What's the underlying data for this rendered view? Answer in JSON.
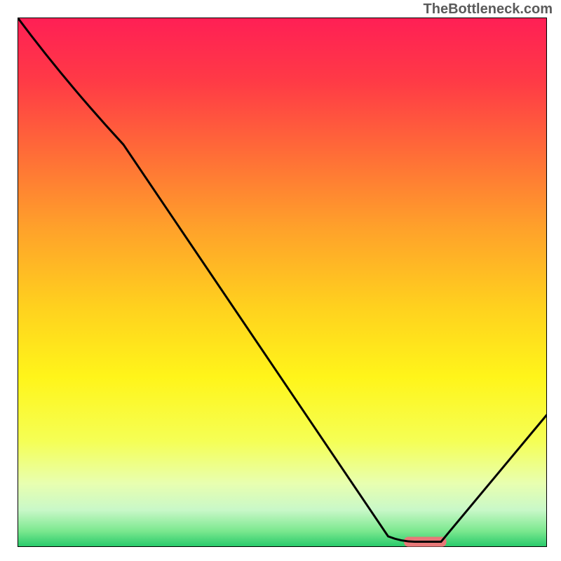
{
  "watermark": "TheBottleneck.com",
  "chart_data": {
    "type": "line",
    "title": "",
    "xlabel": "",
    "ylabel": "",
    "xlim": [
      0,
      100
    ],
    "ylim": [
      0,
      100
    ],
    "series": [
      {
        "name": "bottleneck-curve",
        "x": [
          0,
          20,
          70,
          75,
          80,
          100
        ],
        "values": [
          100,
          76,
          2,
          1,
          1,
          25
        ]
      }
    ],
    "marker": {
      "x_start": 73,
      "x_end": 81,
      "y": 1,
      "color": "#e87878"
    },
    "gradient_stops": [
      {
        "offset": 0,
        "color": "#ff1f55"
      },
      {
        "offset": 12,
        "color": "#ff3a46"
      },
      {
        "offset": 25,
        "color": "#ff6a38"
      },
      {
        "offset": 40,
        "color": "#ffa22a"
      },
      {
        "offset": 55,
        "color": "#ffd21e"
      },
      {
        "offset": 68,
        "color": "#fff51a"
      },
      {
        "offset": 80,
        "color": "#f5ff55"
      },
      {
        "offset": 88,
        "color": "#e8ffb0"
      },
      {
        "offset": 93,
        "color": "#c9f8c8"
      },
      {
        "offset": 97,
        "color": "#7be88f"
      },
      {
        "offset": 100,
        "color": "#26c96a"
      }
    ],
    "border_color": "#000000",
    "curve_color": "#000000",
    "curve_width": 3
  }
}
